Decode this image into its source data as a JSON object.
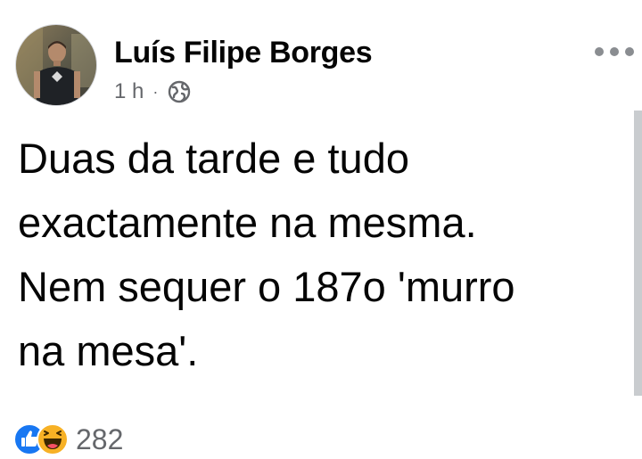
{
  "post": {
    "author_name": "Luís Filipe Borges",
    "time": "1 h",
    "separator": "·",
    "privacy_icon": "globe-icon",
    "text": "Duas da tarde e tudo\nexactamente na mesma.\nNem sequer o 187o 'murro\nna mesa'.",
    "reactions": {
      "icons": [
        "like-icon",
        "haha-icon"
      ],
      "count": "282"
    }
  },
  "colors": {
    "like_blue": "#1877f2",
    "haha_yellow": "#f7b125",
    "secondary_text": "#65676b"
  }
}
